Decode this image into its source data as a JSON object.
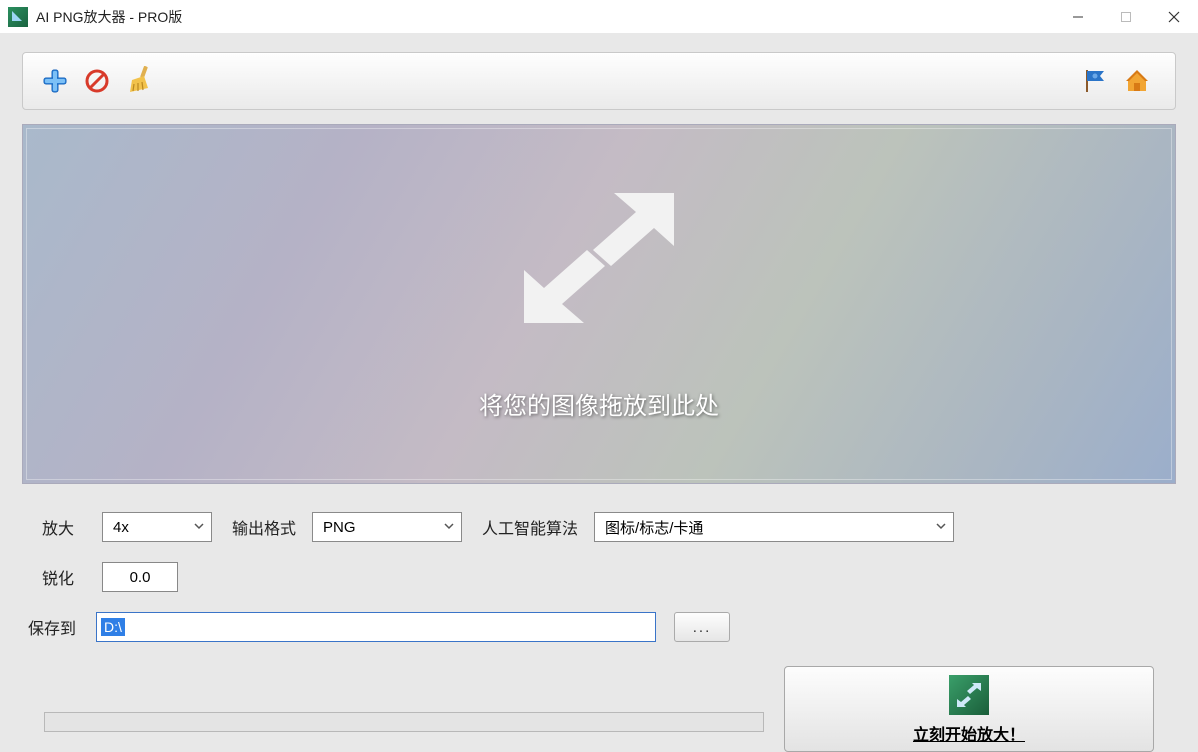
{
  "window": {
    "title": "AI PNG放大器 - PRO版"
  },
  "toolbar": {
    "add_icon": "add-icon",
    "forbid_icon": "forbid-icon",
    "broom_icon": "broom-icon",
    "flag_icon": "flag-icon",
    "home_icon": "home-icon"
  },
  "dropzone": {
    "hint": "将您的图像拖放到此处"
  },
  "controls": {
    "magnify_label": "放大",
    "magnify_value": "4x",
    "format_label": "输出格式",
    "format_value": "PNG",
    "algo_label": "人工智能算法",
    "algo_value": "图标/标志/卡通",
    "sharpen_label": "锐化",
    "sharpen_value": "0.0",
    "save_label": "保存到",
    "save_path": "D:\\",
    "browse_label": "..."
  },
  "start": {
    "label": "立刻开始放大！"
  }
}
